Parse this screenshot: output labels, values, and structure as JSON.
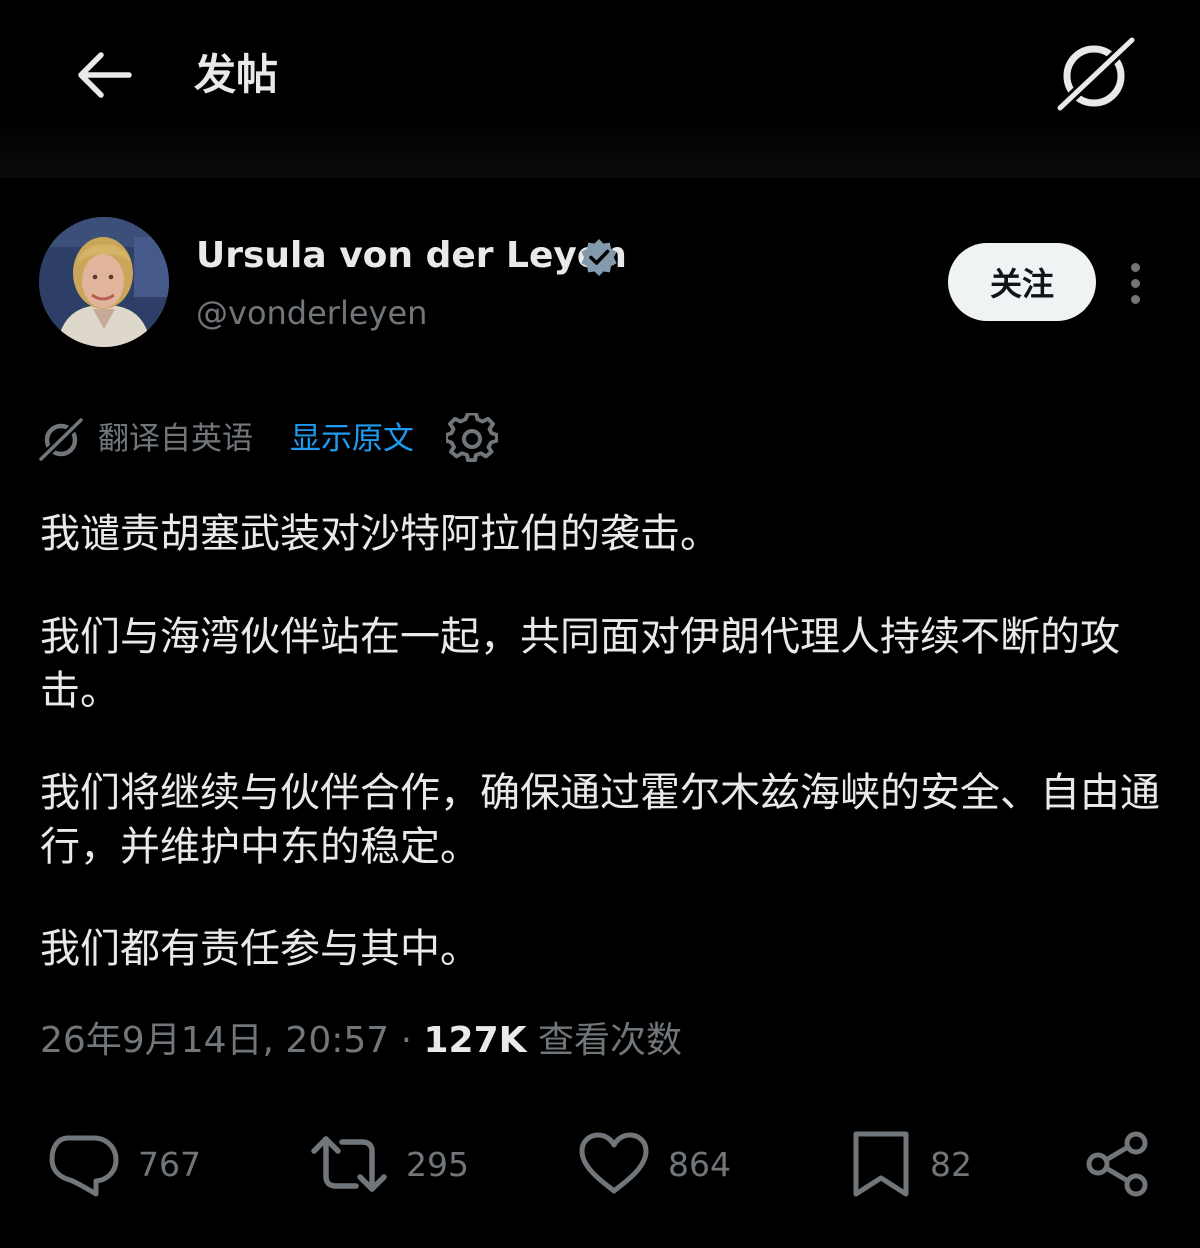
{
  "header": {
    "title": "发帖"
  },
  "author": {
    "name": "Ursula von der Leyen",
    "handle": "@vonderleyen",
    "follow_label": "关注"
  },
  "translation": {
    "label": "翻译自英语",
    "show_original": "显示原文"
  },
  "post": {
    "paragraphs": [
      "我谴责胡塞武装对沙特阿拉伯的袭击。",
      "我们与海湾伙伴站在一起，共同面对伊朗代理人持续不断的攻击。",
      "我们将继续与伙伴合作，确保通过霍尔木兹海峡的安全、自由通行，并维护中东的稳定。",
      "我们都有责任参与其中。"
    ]
  },
  "meta": {
    "timestamp": "26年9月14日, 20:57",
    "separator": " · ",
    "views": "127K",
    "views_label": "查看次数"
  },
  "actions": {
    "replies": "767",
    "reposts": "295",
    "likes": "864",
    "bookmarks": "82"
  },
  "colors": {
    "background": "#000000",
    "text": "#e7e9ea",
    "secondary": "#71767b",
    "link": "#1d9bf0"
  }
}
